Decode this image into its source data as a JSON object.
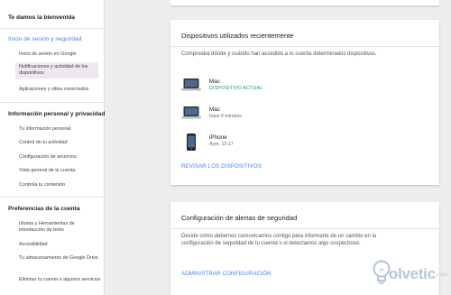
{
  "sidebar": {
    "welcome": "Te damos la bienvenida",
    "sections": [
      {
        "heading": "Inicio de sesión y seguridad",
        "items": [
          "Inicio de sesión en Google",
          "Notificaciones y actividad de los dispositivos",
          "Aplicaciones y sitios conectados"
        ]
      },
      {
        "heading": "Información personal y privacidad",
        "items": [
          "Tu información personal",
          "Control de tu actividad",
          "Configuración de anuncios",
          "Vista general de la cuenta",
          "Controla tu contenido"
        ]
      },
      {
        "heading": "Preferencias de la cuenta",
        "items": [
          "Idioma y Herramientas de introducción de texto",
          "Accesibilidad",
          "Tu almacenamiento de Google Drive",
          "Eliminar tu cuenta o algunos servicios"
        ]
      }
    ]
  },
  "devices_card": {
    "title": "Dispositivos utilizados recientemente",
    "description": "Comprueba dónde y cuándo han accedido a tu cuenta determinados dispositivos.",
    "devices": [
      {
        "name": "Mac",
        "status": "DISPOSITIVO ACTUAL",
        "icon": "laptop-icon"
      },
      {
        "name": "Mac",
        "status": "hace 6 minutos",
        "icon": "laptop-icon"
      },
      {
        "name": "iPhone",
        "status": "Ayer, 13:17",
        "icon": "phone-icon"
      }
    ],
    "link": "REVISAR LOS DISPOSITIVOS"
  },
  "alerts_card": {
    "title": "Configuración de alertas de seguridad",
    "description": "Decide cómo debemos comunicarnos contigo para informarte de un cambio en la configuración de seguridad de tu cuenta o si detectamos algo sospechoso.",
    "link": "ADMINISTRAR CONFIGURACIÓN"
  },
  "watermark": {
    "text": "olvetic",
    "suffix": ".com"
  },
  "colors": {
    "accent": "#4285f4",
    "current_device": "#0f9d58",
    "selected_bg": "#efe6ee"
  }
}
